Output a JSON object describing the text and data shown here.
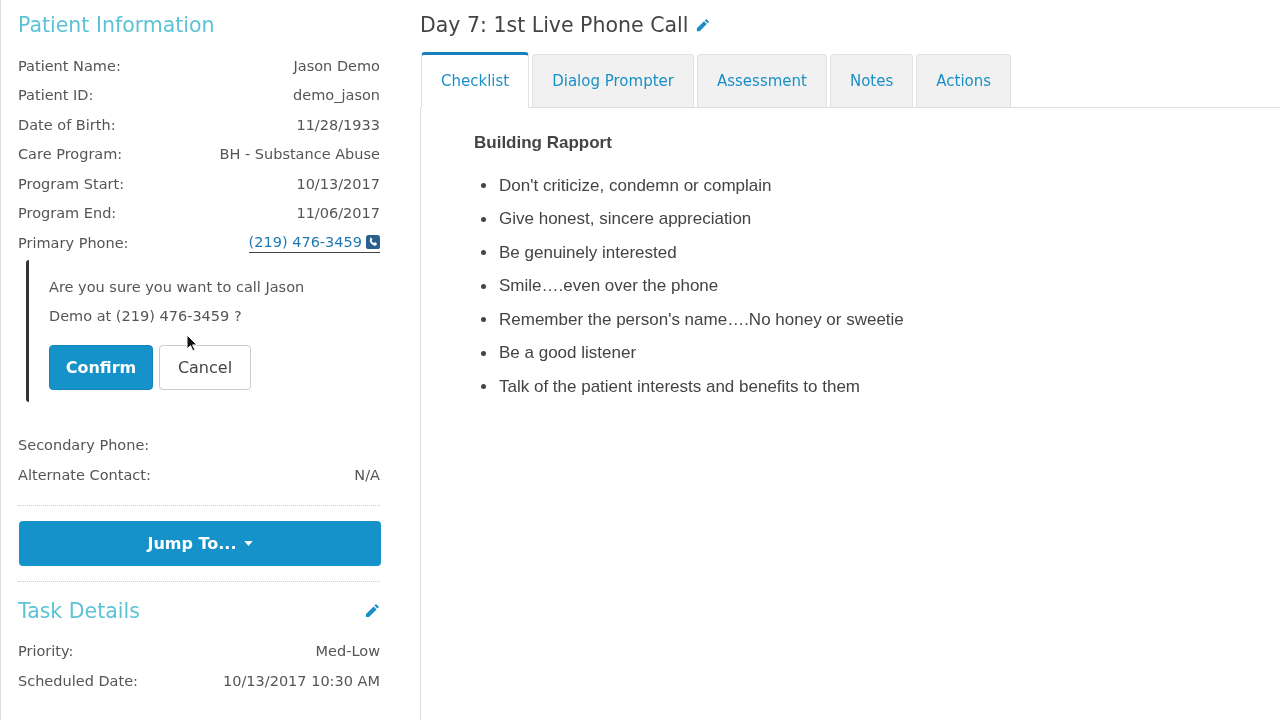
{
  "patient_information": {
    "title": "Patient Information",
    "fields": [
      {
        "label": "Patient Name:",
        "value": "Jason Demo",
        "kind": "text"
      },
      {
        "label": "Patient ID:",
        "value": "demo_jason",
        "kind": "text"
      },
      {
        "label": "Date of Birth:",
        "value": "11/28/1933",
        "kind": "text"
      },
      {
        "label": "Care Program:",
        "value": "BH - Substance Abuse",
        "kind": "text"
      },
      {
        "label": "Program Start:",
        "value": "10/13/2017",
        "kind": "text"
      },
      {
        "label": "Program End:",
        "value": "11/06/2017",
        "kind": "text"
      },
      {
        "label": "Primary Phone:",
        "value": "(219) 476-3459",
        "kind": "phone"
      }
    ],
    "call_confirmation": {
      "message": "Are you sure you want to call Jason Demo at (219) 476-3459 ?",
      "buttons": [
        {
          "label": "Confirm",
          "kind": "primary"
        },
        {
          "label": "Cancel",
          "kind": "default"
        }
      ]
    },
    "contact_fields": [
      {
        "label": "Secondary Phone:",
        "kind": "text"
      },
      {
        "label": "Alternate Contact:",
        "value": "N/A",
        "kind": "text"
      }
    ]
  },
  "jump_button": {
    "label": "Jump To..."
  },
  "task_details": {
    "title": "Task Details",
    "fields": [
      {
        "label": "Priority:",
        "value": "Med-Low"
      },
      {
        "label": "Scheduled Date:",
        "value": "10/13/2017 10:30 AM"
      }
    ]
  },
  "task": {
    "title": "Day 7: 1st Live Phone Call"
  },
  "tabs": [
    {
      "label": "Checklist",
      "selected": true
    },
    {
      "label": "Dialog Prompter",
      "selected": false
    },
    {
      "label": "Assessment",
      "selected": false
    },
    {
      "label": "Notes",
      "selected": false
    },
    {
      "label": "Actions",
      "selected": false
    }
  ],
  "checklist": {
    "heading": "Building Rapport",
    "items": [
      "Don't criticize, condemn or complain",
      "Give honest, sincere appreciation",
      "Be genuinely interested",
      "Smile….even over the phone",
      "Remember the person's name….No honey or sweetie",
      "Be a good listener",
      "Talk of the patient interests and benefits to them"
    ]
  }
}
